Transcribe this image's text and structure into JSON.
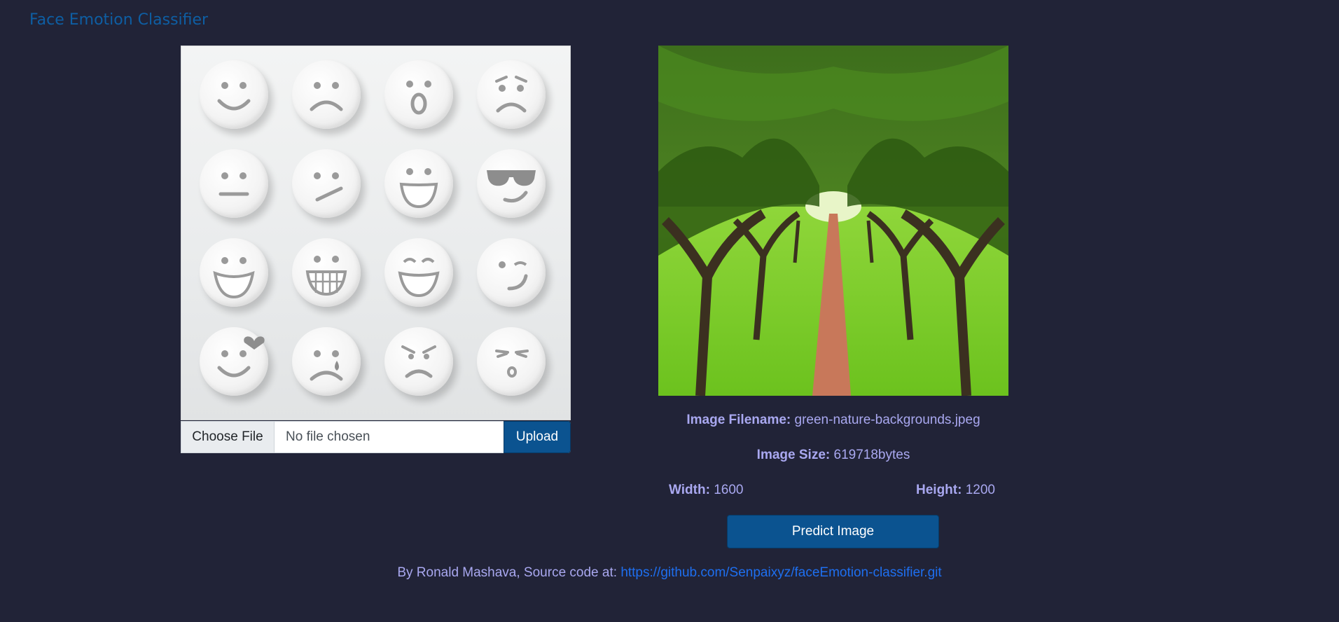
{
  "navbar": {
    "brand": "Face Emotion Classifier"
  },
  "upload": {
    "placeholder_image": "emoji-faces-grid",
    "emojis": [
      "smile",
      "sad",
      "surprised",
      "worried",
      "neutral",
      "smirk",
      "grin",
      "cool-sunglasses",
      "laugh",
      "big-grin",
      "happy-closed-eyes",
      "wink",
      "love",
      "crying",
      "angry",
      "kiss"
    ],
    "choose_file_label": "Choose File",
    "file_status": "No file chosen",
    "upload_label": "Upload"
  },
  "preview": {
    "image": "green-nature-tree-path",
    "filename_label": "Image Filename:",
    "filename_value": "green-nature-backgrounds.jpeg",
    "size_label": "Image Size:",
    "size_value": "619718bytes",
    "width_label": "Width:",
    "width_value": "1600",
    "height_label": "Height:",
    "height_value": "1200",
    "predict_label": "Predict Image"
  },
  "footer": {
    "text": "By Ronald Mashava, Source code at: ",
    "link_text": "https://github.com/Senpaixyz/faceEmotion-classifier.git"
  },
  "colors": {
    "background": "#212337",
    "brand": "#0e5ea3",
    "accent_button": "#0b5390",
    "info_text": "#a9a8f0",
    "link": "#1e6ff0"
  }
}
